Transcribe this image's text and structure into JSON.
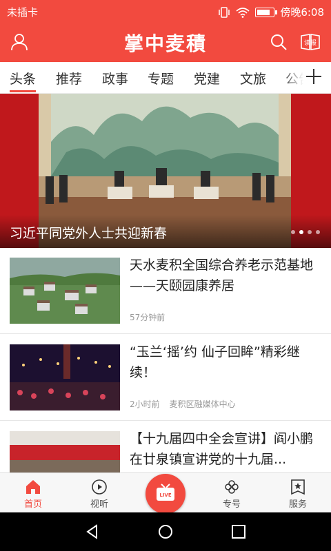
{
  "status_bar": {
    "carrier": "未插卡",
    "time": "傍晚6:08"
  },
  "header": {
    "title": "掌中麦積",
    "book_icon_text": "读报"
  },
  "tabs": [
    {
      "label": "头条",
      "active": true
    },
    {
      "label": "推荐"
    },
    {
      "label": "政事"
    },
    {
      "label": "专题"
    },
    {
      "label": "党建"
    },
    {
      "label": "文旅"
    },
    {
      "label": "公告"
    }
  ],
  "banner": {
    "caption": "习近平同党外人士共迎新春",
    "slide_count": 4,
    "active_slide": 2
  },
  "news": [
    {
      "title": "天水麦积全国综合养老示范基地——天颐园康养居",
      "time": "57分钟前",
      "source": ""
    },
    {
      "title": "“玉兰‘摇’约 仙子回眸”精彩继续！",
      "time": "2小时前",
      "source": "麦积区融媒体中心"
    },
    {
      "title": "【十九届四中全会宣讲】阎小鹏在廿泉镇宣讲党的十九届...",
      "time": "",
      "source": ""
    }
  ],
  "bottom_tabs": [
    {
      "label": "首页",
      "icon": "home-icon",
      "active": true
    },
    {
      "label": "视听",
      "icon": "play-icon"
    },
    {
      "label": "LIVE",
      "icon": "live-tv-icon"
    },
    {
      "label": "专号",
      "icon": "flower-icon"
    },
    {
      "label": "服务",
      "icon": "star-box-icon"
    }
  ],
  "colors": {
    "brand": "#f24a3f",
    "banner_bg": "#c0181c"
  }
}
